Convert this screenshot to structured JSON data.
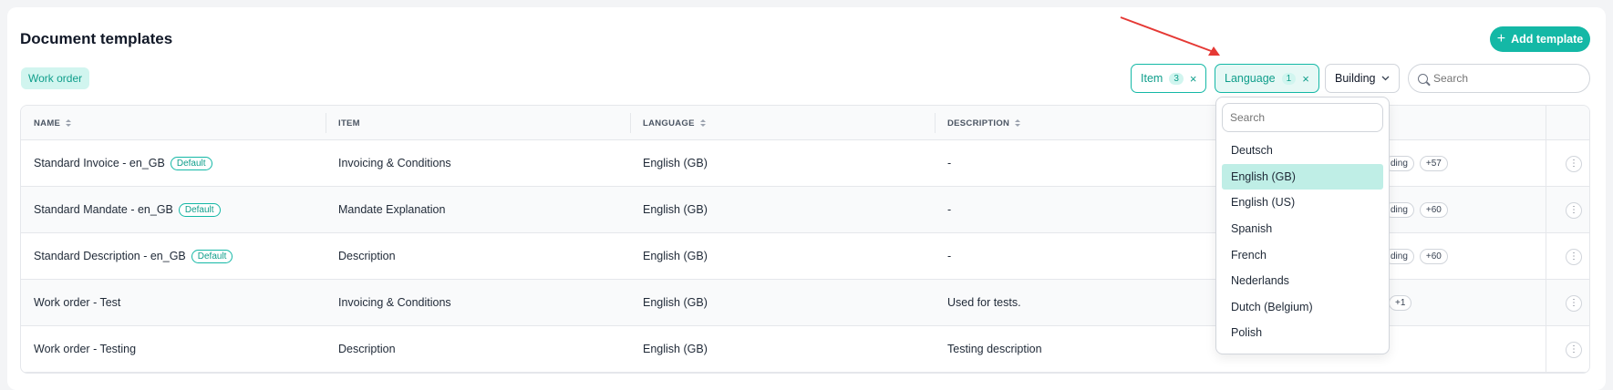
{
  "header": {
    "title": "Document templates",
    "add_button": "Add template"
  },
  "tag": "Work order",
  "filters": {
    "item": {
      "label": "Item",
      "count": "3"
    },
    "language": {
      "label": "Language",
      "count": "1"
    },
    "building": {
      "label": "Building"
    }
  },
  "search": {
    "placeholder": "Search"
  },
  "table": {
    "columns": [
      "NAME",
      "ITEM",
      "LANGUAGE",
      "DESCRIPTION"
    ],
    "rows": [
      {
        "name": "Standard Invoice - en_GB",
        "badge": "Default",
        "item": "Invoicing & Conditions",
        "language": "English (GB)",
        "description": "-",
        "tag": "ding",
        "more": "+57"
      },
      {
        "name": "Standard Mandate - en_GB",
        "badge": "Default",
        "item": "Mandate Explanation",
        "language": "English (GB)",
        "description": "-",
        "tag": "ding",
        "more": "+60"
      },
      {
        "name": "Standard Description - en_GB",
        "badge": "Default",
        "item": "Description",
        "language": "English (GB)",
        "description": "-",
        "tag": "ding",
        "more": "+60"
      },
      {
        "name": "Work order - Test",
        "badge": "",
        "item": "Invoicing & Conditions",
        "language": "English (GB)",
        "description": "Used for tests.",
        "tag": "",
        "more": "+1"
      },
      {
        "name": "Work order - Testing",
        "badge": "",
        "item": "Description",
        "language": "English (GB)",
        "description": "Testing description",
        "tag": "",
        "more": ""
      }
    ]
  },
  "dropdown": {
    "search_placeholder": "Search",
    "options": [
      "Deutsch",
      "English (GB)",
      "English (US)",
      "Spanish",
      "French",
      "Nederlands",
      "Dutch (Belgium)",
      "Polish"
    ],
    "selected": "English (GB)"
  },
  "colors": {
    "accent": "#14b8a6",
    "accent_text": "#0f9e8b",
    "selected_bg": "#bfeee6",
    "arrow": "#e53935"
  }
}
